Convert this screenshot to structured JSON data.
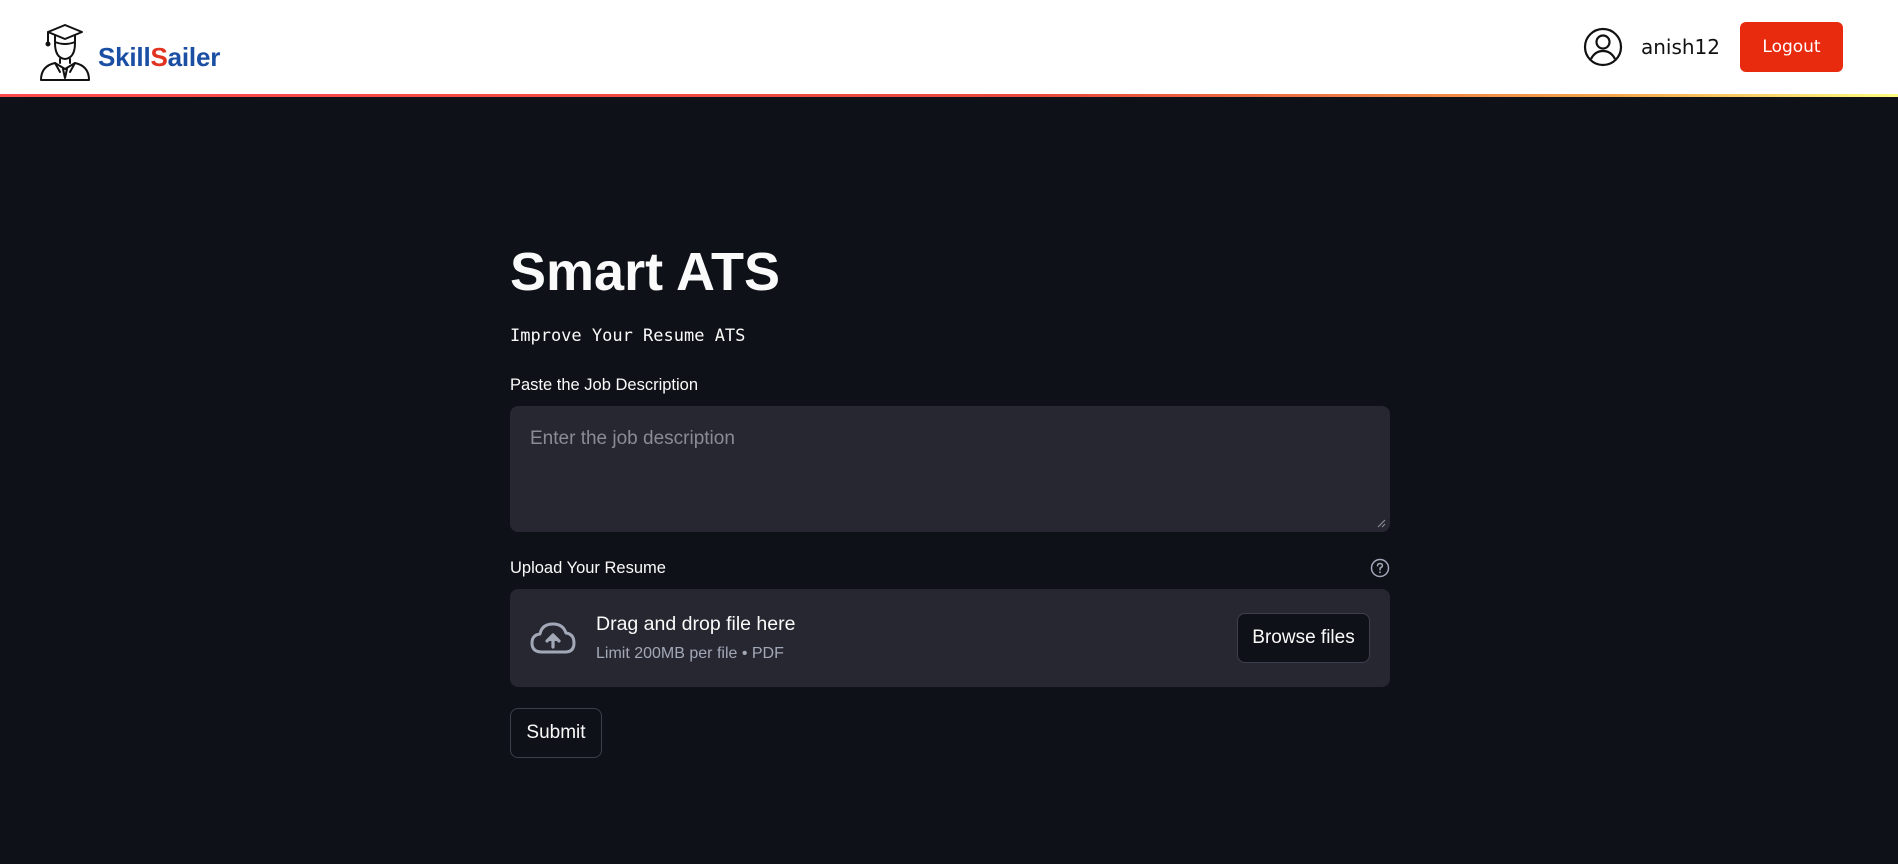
{
  "header": {
    "brand": {
      "part1": "Skill",
      "part2": "S",
      "part3": "ailer"
    },
    "username": "anish12",
    "logout_label": "Logout",
    "colors": {
      "brand_blue": "#1a4fa3",
      "brand_red": "#e03322",
      "logout_bg": "#e82a0e"
    }
  },
  "main": {
    "title": "Smart ATS",
    "subtitle": "Improve Your Resume ATS",
    "job_description": {
      "label": "Paste the Job Description",
      "placeholder": "Enter the job description",
      "value": ""
    },
    "resume_upload": {
      "label": "Upload Your Resume",
      "help_icon": "question-circle-icon",
      "drop_title": "Drag and drop file here",
      "drop_limit": "Limit 200MB per file • PDF",
      "browse_label": "Browse files",
      "upload_icon": "cloud-upload-icon"
    },
    "submit_label": "Submit"
  },
  "theme": {
    "background": "#0e1117",
    "input_bg": "#262730",
    "text": "#fafafa"
  }
}
